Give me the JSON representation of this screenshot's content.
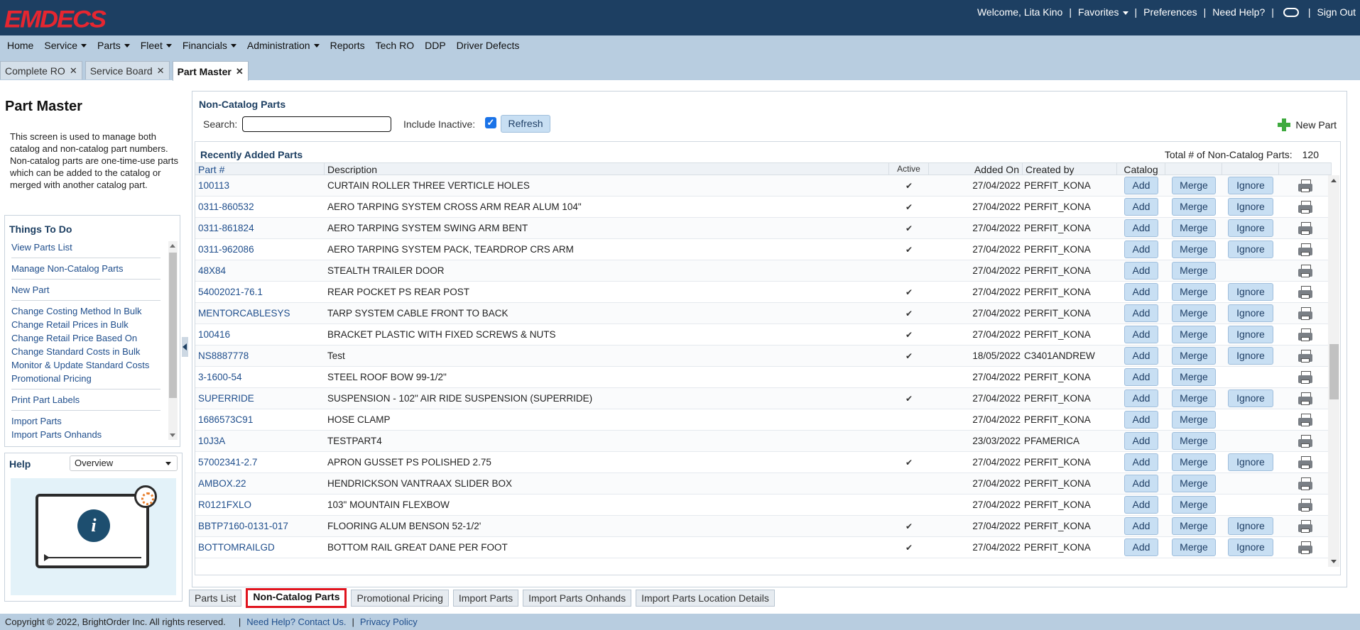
{
  "header": {
    "logo": "EMDECS",
    "welcome": "Welcome, Lita Kino",
    "favorites": "Favorites",
    "preferences": "Preferences",
    "need_help": "Need Help?",
    "sign_out": "Sign Out"
  },
  "menu": [
    "Home",
    "Service",
    "Parts",
    "Fleet",
    "Financials",
    "Administration",
    "Reports",
    "Tech RO",
    "DDP",
    "Driver Defects"
  ],
  "menu_dropdowns": [
    false,
    true,
    true,
    true,
    true,
    true,
    false,
    false,
    false,
    false
  ],
  "screen_tabs": [
    {
      "label": "Complete RO",
      "active": false
    },
    {
      "label": "Service Board",
      "active": false
    },
    {
      "label": "Part Master",
      "active": true
    }
  ],
  "left": {
    "title": "Part Master",
    "description": "This screen is used to manage both catalog and non-catalog part numbers. Non-catalog parts are one-time-use parts which can be added to the catalog or merged with another catalog part.",
    "todo_title": "Things To Do",
    "todo_groups": [
      [
        "View Parts List"
      ],
      [
        "Manage Non-Catalog Parts"
      ],
      [
        "New Part"
      ],
      [
        "Change Costing Method In Bulk",
        "Change Retail Prices in Bulk",
        "Change Retail Price Based On",
        "Change Standard Costs in Bulk",
        "Monitor & Update Standard Costs",
        "Promotional Pricing"
      ],
      [
        "Print Part Labels"
      ],
      [
        "Import Parts",
        "Import Parts Onhands"
      ]
    ],
    "help_title": "Help",
    "help_select": "Overview"
  },
  "panel": {
    "title": "Non-Catalog Parts",
    "search_label": "Search:",
    "search_value": "",
    "include_inactive_label": "Include Inactive:",
    "include_inactive_checked": true,
    "refresh": "Refresh",
    "new_part": "New Part",
    "recent_title": "Recently Added Parts",
    "total_label": "Total # of Non-Catalog Parts:",
    "total_value": "120",
    "columns": [
      "Part #",
      "Description",
      "Active",
      "Added On",
      "Created by",
      "Catalog",
      "",
      "",
      ""
    ],
    "btn_add": "Add",
    "btn_merge": "Merge",
    "btn_ignore": "Ignore",
    "rows": [
      {
        "part": "100113",
        "desc": "CURTAIN ROLLER THREE VERTICLE HOLES",
        "active": true,
        "added": "27/04/2022",
        "by": "PERFIT_KONA",
        "ignore": true
      },
      {
        "part": "0311-860532",
        "desc": "AERO TARPING SYSTEM CROSS ARM REAR ALUM 104\"",
        "active": true,
        "added": "27/04/2022",
        "by": "PERFIT_KONA",
        "ignore": true
      },
      {
        "part": "0311-861824",
        "desc": "AERO TARPING SYSTEM SWING ARM BENT",
        "active": true,
        "added": "27/04/2022",
        "by": "PERFIT_KONA",
        "ignore": true
      },
      {
        "part": "0311-962086",
        "desc": "AERO TARPING SYSTEM PACK, TEARDROP CRS ARM",
        "active": true,
        "added": "27/04/2022",
        "by": "PERFIT_KONA",
        "ignore": true
      },
      {
        "part": "48X84",
        "desc": "STEALTH TRAILER DOOR",
        "active": false,
        "added": "27/04/2022",
        "by": "PERFIT_KONA",
        "ignore": false
      },
      {
        "part": "54002021-76.1",
        "desc": "REAR POCKET PS REAR POST",
        "active": true,
        "added": "27/04/2022",
        "by": "PERFIT_KONA",
        "ignore": true
      },
      {
        "part": "MENTORCABLESYS",
        "desc": "TARP SYSTEM CABLE FRONT TO BACK",
        "active": true,
        "added": "27/04/2022",
        "by": "PERFIT_KONA",
        "ignore": true
      },
      {
        "part": "100416",
        "desc": "BRACKET PLASTIC WITH FIXED SCREWS & NUTS",
        "active": true,
        "added": "27/04/2022",
        "by": "PERFIT_KONA",
        "ignore": true
      },
      {
        "part": "NS8887778",
        "desc": "Test",
        "active": true,
        "added": "18/05/2022",
        "by": "C3401ANDREW",
        "ignore": true
      },
      {
        "part": "3-1600-54",
        "desc": "STEEL ROOF BOW 99-1/2\"",
        "active": false,
        "added": "27/04/2022",
        "by": "PERFIT_KONA",
        "ignore": false
      },
      {
        "part": "SUPERRIDE",
        "desc": "SUSPENSION - 102\" AIR RIDE SUSPENSION (SUPERRIDE)",
        "active": true,
        "added": "27/04/2022",
        "by": "PERFIT_KONA",
        "ignore": true
      },
      {
        "part": "1686573C91",
        "desc": "HOSE CLAMP",
        "active": false,
        "added": "27/04/2022",
        "by": "PERFIT_KONA",
        "ignore": false
      },
      {
        "part": "10J3A",
        "desc": "TESTPART4",
        "active": false,
        "added": "23/03/2022",
        "by": "PFAMERICA",
        "ignore": false
      },
      {
        "part": "57002341-2.7",
        "desc": "APRON GUSSET PS POLISHED 2.75",
        "active": true,
        "added": "27/04/2022",
        "by": "PERFIT_KONA",
        "ignore": true
      },
      {
        "part": "AMBOX.22",
        "desc": "HENDRICKSON VANTRAAX SLIDER BOX",
        "active": false,
        "added": "27/04/2022",
        "by": "PERFIT_KONA",
        "ignore": false
      },
      {
        "part": "R0121FXLO",
        "desc": "103\" MOUNTAIN FLEXBOW",
        "active": false,
        "added": "27/04/2022",
        "by": "PERFIT_KONA",
        "ignore": false
      },
      {
        "part": "BBTP7160-0131-017",
        "desc": "FLOORING ALUM BENSON 52-1/2'",
        "active": true,
        "added": "27/04/2022",
        "by": "PERFIT_KONA",
        "ignore": true
      },
      {
        "part": "BOTTOMRAILGD",
        "desc": "BOTTOM RAIL GREAT DANE PER FOOT",
        "active": true,
        "added": "27/04/2022",
        "by": "PERFIT_KONA",
        "ignore": true
      }
    ]
  },
  "bottom_tabs": [
    {
      "label": "Parts List",
      "active": false
    },
    {
      "label": "Non-Catalog Parts",
      "active": true
    },
    {
      "label": "Promotional Pricing",
      "active": false
    },
    {
      "label": "Import Parts",
      "active": false
    },
    {
      "label": "Import Parts Onhands",
      "active": false
    },
    {
      "label": "Import Parts Location Details",
      "active": false
    }
  ],
  "footer": {
    "copyright": "Copyright © 2022, BrightOrder Inc. All rights reserved.",
    "help_link": "Need Help? Contact Us.",
    "privacy_link": "Privacy Policy"
  },
  "colors": {
    "brand_red": "#e62630",
    "header_bg": "#1d3f62",
    "accent_highlight": "#e0141e"
  }
}
